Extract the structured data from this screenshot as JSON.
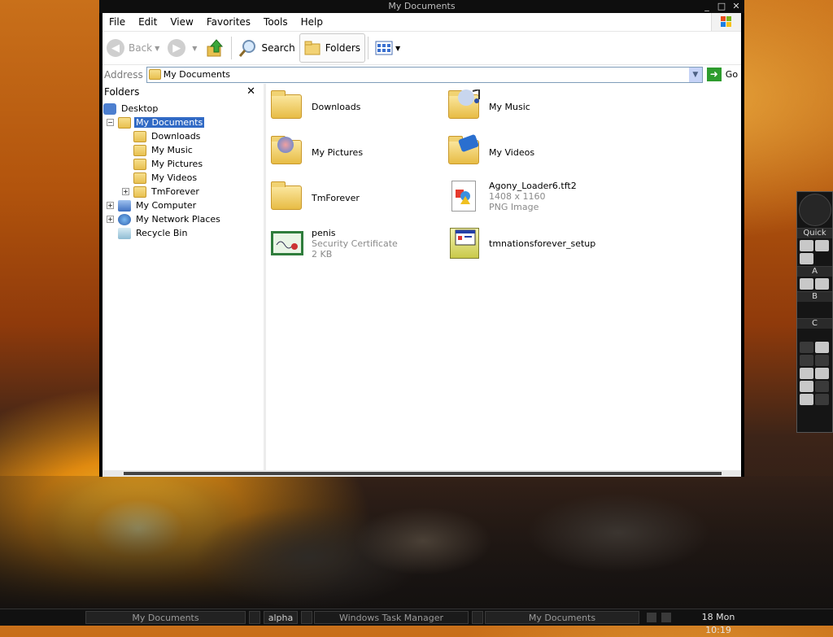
{
  "window": {
    "title": "My Documents",
    "min": "_",
    "max": "□",
    "close": "✕"
  },
  "menu": [
    "File",
    "Edit",
    "View",
    "Favorites",
    "Tools",
    "Help"
  ],
  "toolbar": {
    "back": "Back",
    "search": "Search",
    "folders": "Folders"
  },
  "address": {
    "label": "Address",
    "value": "My Documents",
    "go": "Go"
  },
  "folders_pane": {
    "title": "Folders",
    "close": "✕",
    "items": [
      "Desktop",
      "My Documents",
      "Downloads",
      "My Music",
      "My Pictures",
      "My Videos",
      "TmForever",
      "My Computer",
      "My Network Places",
      "Recycle Bin"
    ]
  },
  "files": [
    {
      "name": "Downloads"
    },
    {
      "name": "My Music"
    },
    {
      "name": "My Pictures"
    },
    {
      "name": "My Videos"
    },
    {
      "name": "TmForever"
    },
    {
      "name": "Agony_Loader6.tft2",
      "line2": "1408 x 1160",
      "line3": "PNG Image"
    },
    {
      "name": "penis",
      "line2": "Security Certificate",
      "line3": "2 KB"
    },
    {
      "name": "tmnationsforever_setup"
    }
  ],
  "dock": {
    "quick": "Quick",
    "a": "A",
    "b": "B",
    "c": "C"
  },
  "taskbar": {
    "tasks": [
      "My Documents",
      "alpha",
      "Windows Task Manager",
      "My Documents"
    ],
    "clock": "18 Mon 10:19"
  },
  "colors": {
    "selection": "#316ac5",
    "go_button": "#2e9c2e"
  }
}
